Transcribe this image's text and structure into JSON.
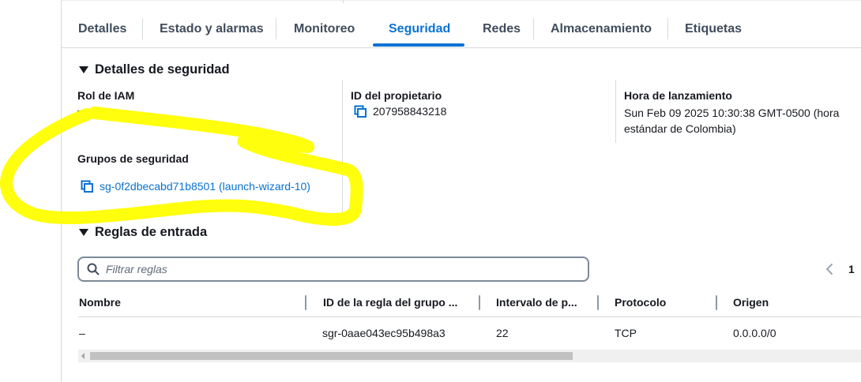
{
  "tabs": [
    {
      "label": "Detalles"
    },
    {
      "label": "Estado y alarmas"
    },
    {
      "label": "Monitoreo"
    },
    {
      "label": "Seguridad"
    },
    {
      "label": "Redes"
    },
    {
      "label": "Almacenamiento"
    },
    {
      "label": "Etiquetas"
    }
  ],
  "active_tab": "Seguridad",
  "security_details": {
    "title": "Detalles de seguridad",
    "iam_role_label": "Rol de IAM",
    "iam_role_value": "–",
    "owner_id_label": "ID del propietario",
    "owner_id_value": "207958843218",
    "launch_time_label": "Hora de lanzamiento",
    "launch_time_value": "Sun Feb 09 2025 10:30:38 GMT-0500 (hora estándar de Colombia)",
    "security_groups_label": "Grupos de seguridad",
    "security_group_link": "sg-0f2dbecabd71b8501 (launch-wizard-10)"
  },
  "inbound_rules": {
    "title": "Reglas de entrada",
    "filter_placeholder": "Filtrar reglas",
    "page_number": "1",
    "columns": [
      "Nombre",
      "ID de la regla del grupo ...",
      "Intervalo de p...",
      "Protocolo",
      "Origen"
    ],
    "rows": [
      {
        "name": "–",
        "rule_id": "sgr-0aae043ec95b498a3",
        "port_range": "22",
        "protocol": "TCP",
        "source": "0.0.0.0/0"
      }
    ]
  },
  "colors": {
    "accent": "#0972d3",
    "text": "#16191f",
    "annotation_highlight": "#ffff00"
  },
  "icons": [
    "copy-icon",
    "search-icon",
    "chevron-left-icon",
    "caret-down-icon"
  ]
}
